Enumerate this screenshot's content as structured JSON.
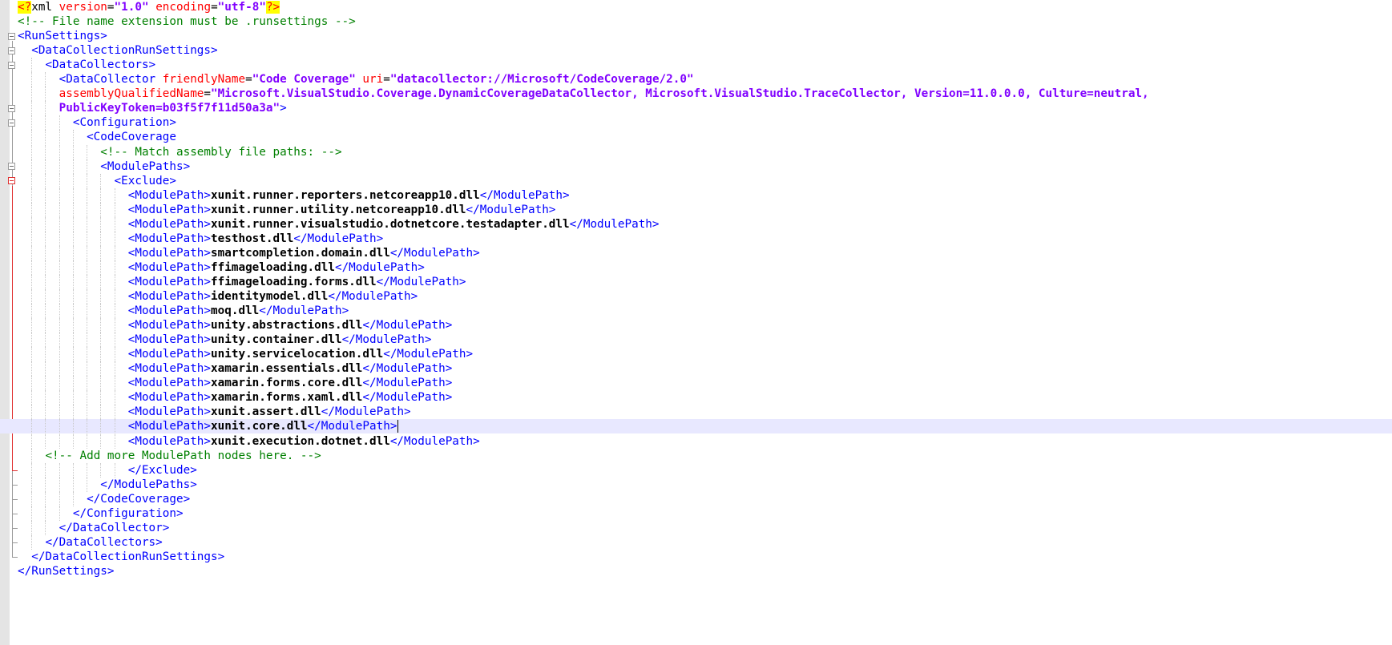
{
  "editor": {
    "lines": [
      [
        {
          "t": "<?",
          "c": "pi"
        },
        {
          "t": "xml ",
          "c": "plain"
        },
        {
          "t": "version",
          "c": "attr"
        },
        {
          "t": "=",
          "c": "plain"
        },
        {
          "t": "\"1.0\"",
          "c": "val"
        },
        {
          "t": " ",
          "c": "plain"
        },
        {
          "t": "encoding",
          "c": "attr"
        },
        {
          "t": "=",
          "c": "plain"
        },
        {
          "t": "\"utf-8\"",
          "c": "val"
        },
        {
          "t": "?>",
          "c": "pi"
        }
      ],
      [
        {
          "t": "<!-- File name extension must be .runsettings -->",
          "c": "comment"
        }
      ],
      [
        {
          "t": "<RunSettings>",
          "c": "tag"
        }
      ],
      [
        {
          "t": "  ",
          "c": "plain"
        },
        {
          "t": "<DataCollectionRunSettings>",
          "c": "tag"
        }
      ],
      [
        {
          "t": "    ",
          "c": "plain"
        },
        {
          "t": "<DataCollectors>",
          "c": "tag"
        }
      ],
      [
        {
          "t": "      ",
          "c": "plain"
        },
        {
          "t": "<DataCollector ",
          "c": "tag"
        },
        {
          "t": "friendlyName",
          "c": "attr"
        },
        {
          "t": "=",
          "c": "plain"
        },
        {
          "t": "\"Code Coverage\"",
          "c": "val"
        },
        {
          "t": " ",
          "c": "plain"
        },
        {
          "t": "uri",
          "c": "attr"
        },
        {
          "t": "=",
          "c": "plain"
        },
        {
          "t": "\"datacollector://Microsoft/CodeCoverage/2.0\"",
          "c": "val"
        }
      ],
      [
        {
          "t": "      ",
          "c": "plain"
        },
        {
          "t": "assemblyQualifiedName",
          "c": "attr"
        },
        {
          "t": "=",
          "c": "plain"
        },
        {
          "t": "\"Microsoft.VisualStudio.Coverage.DynamicCoverageDataCollector, Microsoft.VisualStudio.TraceCollector, Version=11.0.0.0, Culture=neutral,",
          "c": "val"
        }
      ],
      [
        {
          "t": "      ",
          "c": "plain"
        },
        {
          "t": "PublicKeyToken=b03f5f7f11d50a3a\"",
          "c": "val"
        },
        {
          "t": ">",
          "c": "tag"
        }
      ],
      [
        {
          "t": "        ",
          "c": "plain"
        },
        {
          "t": "<Configuration>",
          "c": "tag"
        }
      ],
      [
        {
          "t": "          ",
          "c": "plain"
        },
        {
          "t": "<CodeCoverage",
          "c": "tag"
        }
      ],
      [
        {
          "t": "            ",
          "c": "plain"
        },
        {
          "t": "<!-- Match assembly file paths: -->",
          "c": "comment"
        }
      ],
      [
        {
          "t": "            ",
          "c": "plain"
        },
        {
          "t": "<ModulePaths>",
          "c": "tag"
        }
      ],
      [
        {
          "t": "              ",
          "c": "plain"
        },
        {
          "t": "<Exclude>",
          "c": "tag"
        }
      ],
      [
        {
          "t": "                ",
          "c": "plain"
        },
        {
          "t": "<ModulePath>",
          "c": "tag"
        },
        {
          "t": "xunit.runner.reporters.netcoreapp10.dll",
          "c": "content"
        },
        {
          "t": "</ModulePath>",
          "c": "tag"
        }
      ],
      [
        {
          "t": "                ",
          "c": "plain"
        },
        {
          "t": "<ModulePath>",
          "c": "tag"
        },
        {
          "t": "xunit.runner.utility.netcoreapp10.dll",
          "c": "content"
        },
        {
          "t": "</ModulePath>",
          "c": "tag"
        }
      ],
      [
        {
          "t": "                ",
          "c": "plain"
        },
        {
          "t": "<ModulePath>",
          "c": "tag"
        },
        {
          "t": "xunit.runner.visualstudio.dotnetcore.testadapter.dll",
          "c": "content"
        },
        {
          "t": "</ModulePath>",
          "c": "tag"
        }
      ],
      [
        {
          "t": "                ",
          "c": "plain"
        },
        {
          "t": "<ModulePath>",
          "c": "tag"
        },
        {
          "t": "testhost.dll",
          "c": "content"
        },
        {
          "t": "</ModulePath>",
          "c": "tag"
        }
      ],
      [
        {
          "t": "                ",
          "c": "plain"
        },
        {
          "t": "<ModulePath>",
          "c": "tag"
        },
        {
          "t": "smartcompletion.domain.dll",
          "c": "content"
        },
        {
          "t": "</ModulePath>",
          "c": "tag"
        }
      ],
      [
        {
          "t": "                ",
          "c": "plain"
        },
        {
          "t": "<ModulePath>",
          "c": "tag"
        },
        {
          "t": "ffimageloading.dll",
          "c": "content"
        },
        {
          "t": "</ModulePath>",
          "c": "tag"
        }
      ],
      [
        {
          "t": "                ",
          "c": "plain"
        },
        {
          "t": "<ModulePath>",
          "c": "tag"
        },
        {
          "t": "ffimageloading.forms.dll",
          "c": "content"
        },
        {
          "t": "</ModulePath>",
          "c": "tag"
        }
      ],
      [
        {
          "t": "                ",
          "c": "plain"
        },
        {
          "t": "<ModulePath>",
          "c": "tag"
        },
        {
          "t": "identitymodel.dll",
          "c": "content"
        },
        {
          "t": "</ModulePath>",
          "c": "tag"
        }
      ],
      [
        {
          "t": "                ",
          "c": "plain"
        },
        {
          "t": "<ModulePath>",
          "c": "tag"
        },
        {
          "t": "moq.dll",
          "c": "content"
        },
        {
          "t": "</ModulePath>",
          "c": "tag"
        }
      ],
      [
        {
          "t": "                ",
          "c": "plain"
        },
        {
          "t": "<ModulePath>",
          "c": "tag"
        },
        {
          "t": "unity.abstractions.dll",
          "c": "content"
        },
        {
          "t": "</ModulePath>",
          "c": "tag"
        }
      ],
      [
        {
          "t": "                ",
          "c": "plain"
        },
        {
          "t": "<ModulePath>",
          "c": "tag"
        },
        {
          "t": "unity.container.dll",
          "c": "content"
        },
        {
          "t": "</ModulePath>",
          "c": "tag"
        }
      ],
      [
        {
          "t": "                ",
          "c": "plain"
        },
        {
          "t": "<ModulePath>",
          "c": "tag"
        },
        {
          "t": "unity.servicelocation.dll",
          "c": "content"
        },
        {
          "t": "</ModulePath>",
          "c": "tag"
        }
      ],
      [
        {
          "t": "                ",
          "c": "plain"
        },
        {
          "t": "<ModulePath>",
          "c": "tag"
        },
        {
          "t": "xamarin.essentials.dll",
          "c": "content"
        },
        {
          "t": "</ModulePath>",
          "c": "tag"
        }
      ],
      [
        {
          "t": "                ",
          "c": "plain"
        },
        {
          "t": "<ModulePath>",
          "c": "tag"
        },
        {
          "t": "xamarin.forms.core.dll",
          "c": "content"
        },
        {
          "t": "</ModulePath>",
          "c": "tag"
        }
      ],
      [
        {
          "t": "                ",
          "c": "plain"
        },
        {
          "t": "<ModulePath>",
          "c": "tag"
        },
        {
          "t": "xamarin.forms.xaml.dll",
          "c": "content"
        },
        {
          "t": "</ModulePath>",
          "c": "tag"
        }
      ],
      [
        {
          "t": "                ",
          "c": "plain"
        },
        {
          "t": "<ModulePath>",
          "c": "tag"
        },
        {
          "t": "xunit.assert.dll",
          "c": "content"
        },
        {
          "t": "</ModulePath>",
          "c": "tag"
        }
      ],
      [
        {
          "t": "                ",
          "c": "plain"
        },
        {
          "t": "<ModulePath>",
          "c": "tag"
        },
        {
          "t": "xunit.core.dll",
          "c": "content"
        },
        {
          "t": "</ModulePath>",
          "c": "tag"
        }
      ],
      [
        {
          "t": "                ",
          "c": "plain"
        },
        {
          "t": "<ModulePath>",
          "c": "tag"
        },
        {
          "t": "xunit.execution.dotnet.dll",
          "c": "content"
        },
        {
          "t": "</ModulePath>",
          "c": "tag"
        }
      ],
      [
        {
          "t": "    ",
          "c": "plain"
        },
        {
          "t": "<!-- Add more ModulePath nodes here. -->",
          "c": "comment"
        }
      ],
      [
        {
          "t": "                ",
          "c": "plain"
        },
        {
          "t": "</Exclude>",
          "c": "tag"
        }
      ],
      [
        {
          "t": "            ",
          "c": "plain"
        },
        {
          "t": "</ModulePaths>",
          "c": "tag"
        }
      ],
      [
        {
          "t": "          ",
          "c": "plain"
        },
        {
          "t": "</CodeCoverage>",
          "c": "tag"
        }
      ],
      [
        {
          "t": "        ",
          "c": "plain"
        },
        {
          "t": "</Configuration>",
          "c": "tag"
        }
      ],
      [
        {
          "t": "      ",
          "c": "plain"
        },
        {
          "t": "</DataCollector>",
          "c": "tag"
        }
      ],
      [
        {
          "t": "    ",
          "c": "plain"
        },
        {
          "t": "</DataCollectors>",
          "c": "tag"
        }
      ],
      [
        {
          "t": "  ",
          "c": "plain"
        },
        {
          "t": "</DataCollectionRunSettings>",
          "c": "tag"
        }
      ],
      [
        {
          "t": "</RunSettings>",
          "c": "tag"
        }
      ]
    ],
    "current_line": 29,
    "fold_markers": {
      "2": "open",
      "3": "open",
      "4": "open",
      "7": "open",
      "8": "open",
      "11": "open",
      "12": "open-red",
      "32": "end-red",
      "33": "end",
      "34": "end",
      "35": "end",
      "36": "end",
      "37": "end",
      "38": "end"
    },
    "colors": {
      "tag": "#0000ff",
      "attribute": "#ff0000",
      "value": "#8000ff",
      "comment": "#008000",
      "fold_red": "#e03030",
      "current_line": "#e8e8ff"
    }
  }
}
